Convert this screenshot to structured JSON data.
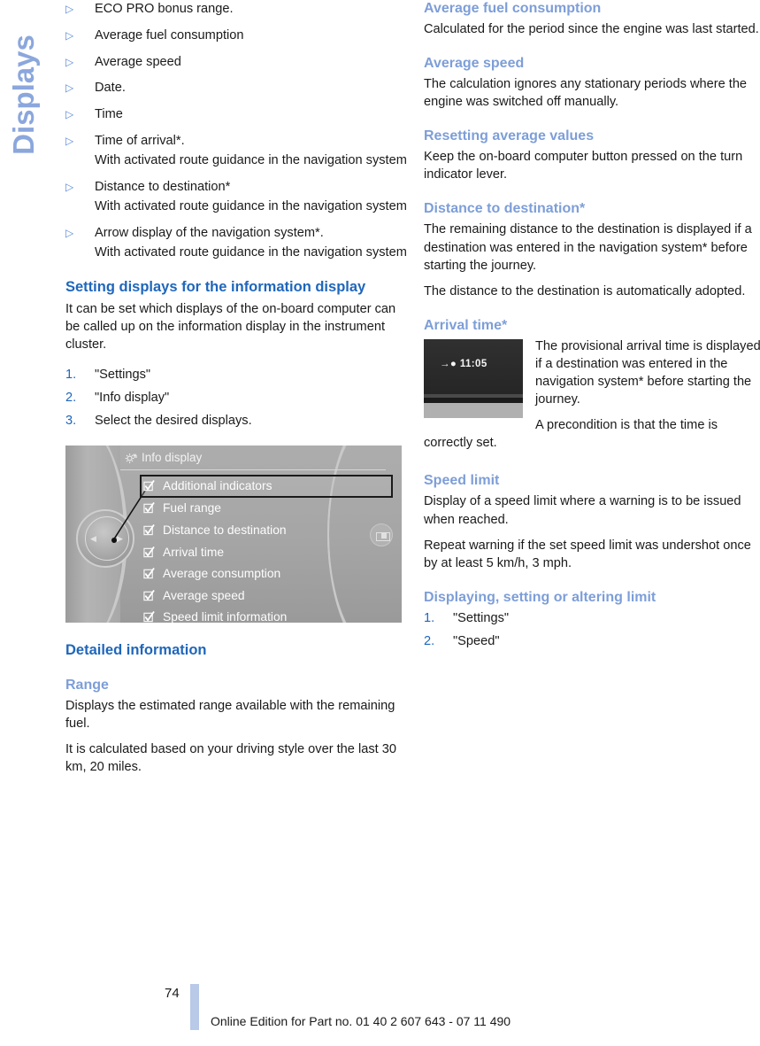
{
  "side_tab": {
    "label": "Displays"
  },
  "left_column": {
    "bullet_list": [
      {
        "marker": "▷",
        "text": "ECO PRO bonus range."
      },
      {
        "marker": "▷",
        "text": "Average fuel consumption"
      },
      {
        "marker": "▷",
        "text": "Average speed"
      },
      {
        "marker": "▷",
        "text": "Date."
      },
      {
        "marker": "▷",
        "text": "Time"
      },
      {
        "marker": "▷",
        "text": "Time of arrival*.",
        "note": "With activated route guidance in the navigation system"
      },
      {
        "marker": "▷",
        "text": "Distance to destination*",
        "note": "With activated route guidance in the navigation system"
      },
      {
        "marker": "▷",
        "text": "Arrow display of the navigation system*.",
        "note": "With activated route guidance in the navigation system"
      }
    ],
    "setting_displays": {
      "heading": "Setting displays for the information display",
      "intro": "It can be set which displays of the on-board computer can be called up on the information display in the instrument cluster.",
      "steps": [
        {
          "number": "1.",
          "text": "\"Settings\""
        },
        {
          "number": "2.",
          "text": "\"Info display\""
        },
        {
          "number": "3.",
          "text": "Select the desired displays."
        }
      ]
    },
    "idrive_figure": {
      "title": "Info display",
      "icon": "gear-icon",
      "items": [
        {
          "label": "Additional indicators",
          "checked": true,
          "selected": true
        },
        {
          "label": "Fuel range",
          "checked": true,
          "selected": false
        },
        {
          "label": "Distance to destination",
          "checked": true,
          "selected": false
        },
        {
          "label": "Arrival time",
          "checked": true,
          "selected": false
        },
        {
          "label": "Average consumption",
          "checked": true,
          "selected": false
        },
        {
          "label": "Average speed",
          "checked": true,
          "selected": false
        },
        {
          "label": "Speed limit information",
          "checked": true,
          "selected": false
        }
      ]
    },
    "detailed_information": {
      "heading": "Detailed information"
    },
    "range": {
      "heading": "Range",
      "p1": "Displays the estimated range available with the remaining fuel.",
      "p2": "It is calculated based on your driving style over the last 30 km, 20 miles."
    }
  },
  "right_column": {
    "average_fuel_consumption": {
      "heading": "Average fuel consumption",
      "p1": "Calculated for the period since the engine was last started."
    },
    "average_speed": {
      "heading": "Average speed",
      "p1": "The calculation ignores any stationary periods where the engine was switched off manually."
    },
    "resetting_average_values": {
      "heading": "Resetting average values",
      "p1": "Keep the on-board computer button pressed on the turn indicator lever."
    },
    "distance_to_destination": {
      "heading": "Distance to destination*",
      "p1": "The remaining distance to the destination is displayed if a destination was entered in the navigation system* before starting the journey.",
      "p2": "The distance to the destination is automatically adopted."
    },
    "arrival_time": {
      "heading": "Arrival time*",
      "figure_text": "→●  11:05",
      "p1": "The provisional arrival time is displayed if a destination was entered in the navigation system* before starting the journey.",
      "p2": "A precondition is that the time is correctly set."
    },
    "speed_limit": {
      "heading": "Speed limit",
      "p1": "Display of a speed limit where a warning is to be issued when reached.",
      "p2": "Repeat warning if the set speed limit was undershot once by at least 5 km/h, 3 mph."
    },
    "displaying_setting_limit": {
      "heading": "Displaying, setting or altering limit",
      "steps": [
        {
          "number": "1.",
          "text": "\"Settings\""
        },
        {
          "number": "2.",
          "text": "\"Speed\""
        }
      ]
    }
  },
  "footer": {
    "page_number": "74",
    "note": "Online Edition for Part no. 01 40 2 607 643 - 07 11 490"
  },
  "colors": {
    "heading_blue": "#1f66bb",
    "subheading_blue": "#7d9ed8",
    "side_tab_blue": "#8ba7dc",
    "footer_bar_blue": "#b9c9e8",
    "body_text": "#1a1a1a"
  }
}
